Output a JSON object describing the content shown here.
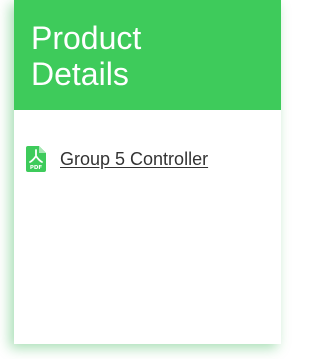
{
  "theme": {
    "accent": "#3ecb5b",
    "pdf_icon_color": "#3ecb5b"
  },
  "card": {
    "title": "Product Details",
    "documents": [
      {
        "icon": "pdf-file-icon",
        "label": "Group 5 Controller"
      }
    ]
  }
}
